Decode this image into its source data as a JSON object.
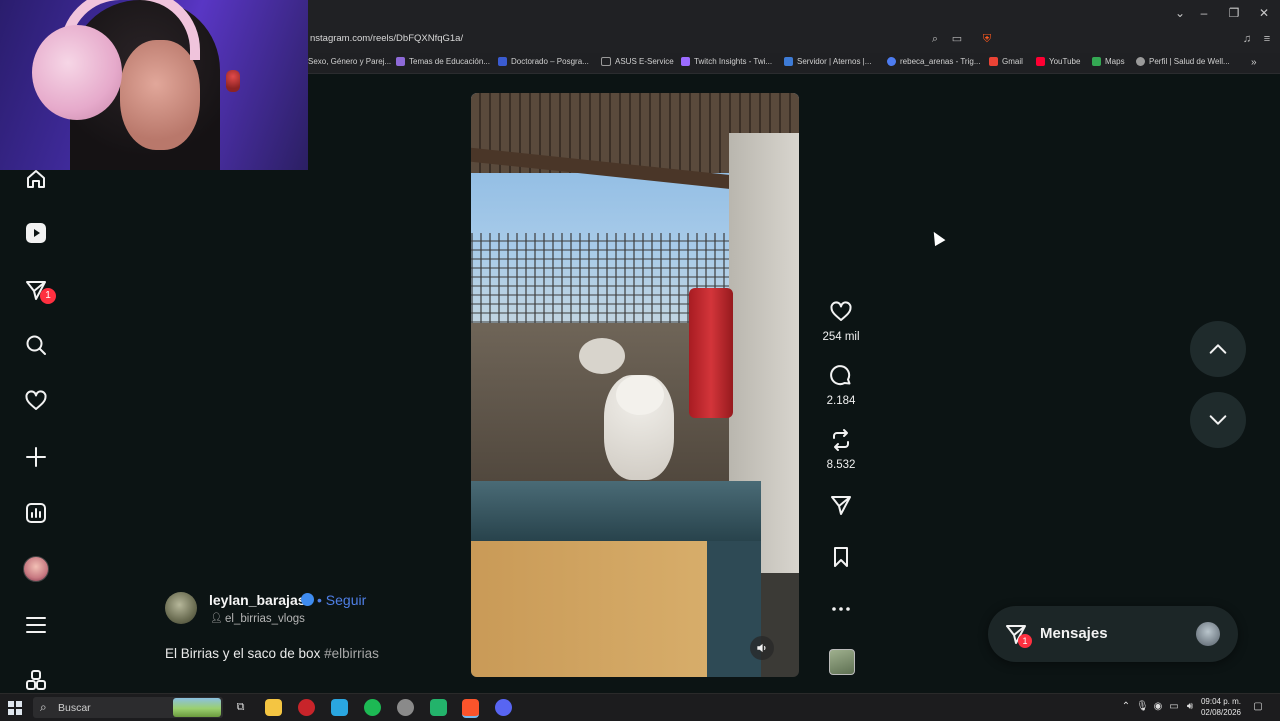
{
  "browser": {
    "url": "nstagram.com/reels/DbFQXNfqG1a/",
    "bookmarks": [
      {
        "label": "Sexo, Género y Parej...",
        "color": "#7a5cc4"
      },
      {
        "label": "Temas de Educación...",
        "color": "#8e6ad8"
      },
      {
        "label": "Doctorado – Posgra...",
        "color": "#3a5bd0"
      },
      {
        "label": "ASUS E-Service",
        "color": "#9a9a9a"
      },
      {
        "label": "Twitch Insights - Twi...",
        "color": "#9b6bff"
      },
      {
        "label": "Servidor | Aternos |...",
        "color": "#3d7bd6"
      },
      {
        "label": "rebeca_arenas - Trig...",
        "color": "#4d7cf0"
      },
      {
        "label": "Gmail",
        "color": "#ea4335"
      },
      {
        "label": "YouTube",
        "color": "#ff0033"
      },
      {
        "label": "Maps",
        "color": "#34a853"
      },
      {
        "label": "Perfil | Salud de Well...",
        "color": "#9a9a9a"
      }
    ]
  },
  "nav": {
    "notifications_badge": "1"
  },
  "reel": {
    "likes": "254 mil",
    "comments": "2.184",
    "reposts": "8.532",
    "username": "leylan_barajas",
    "follow_label": "Seguir",
    "follow_separator": "•",
    "collaborator": "el_birrias_vlogs",
    "caption_text": "El Birrias y el saco de box ",
    "caption_hashtag": "#elbirrias"
  },
  "messages": {
    "label": "Mensajes",
    "badge": "1"
  },
  "taskbar": {
    "search_placeholder": "Buscar",
    "time": "09:04 p. m.",
    "date": "02/08/2026"
  },
  "colors": {
    "page_bg": "#0c1414",
    "badge_red": "#ff3040",
    "follow_blue": "#4f7fe6",
    "verified_blue": "#3f8cf0"
  }
}
